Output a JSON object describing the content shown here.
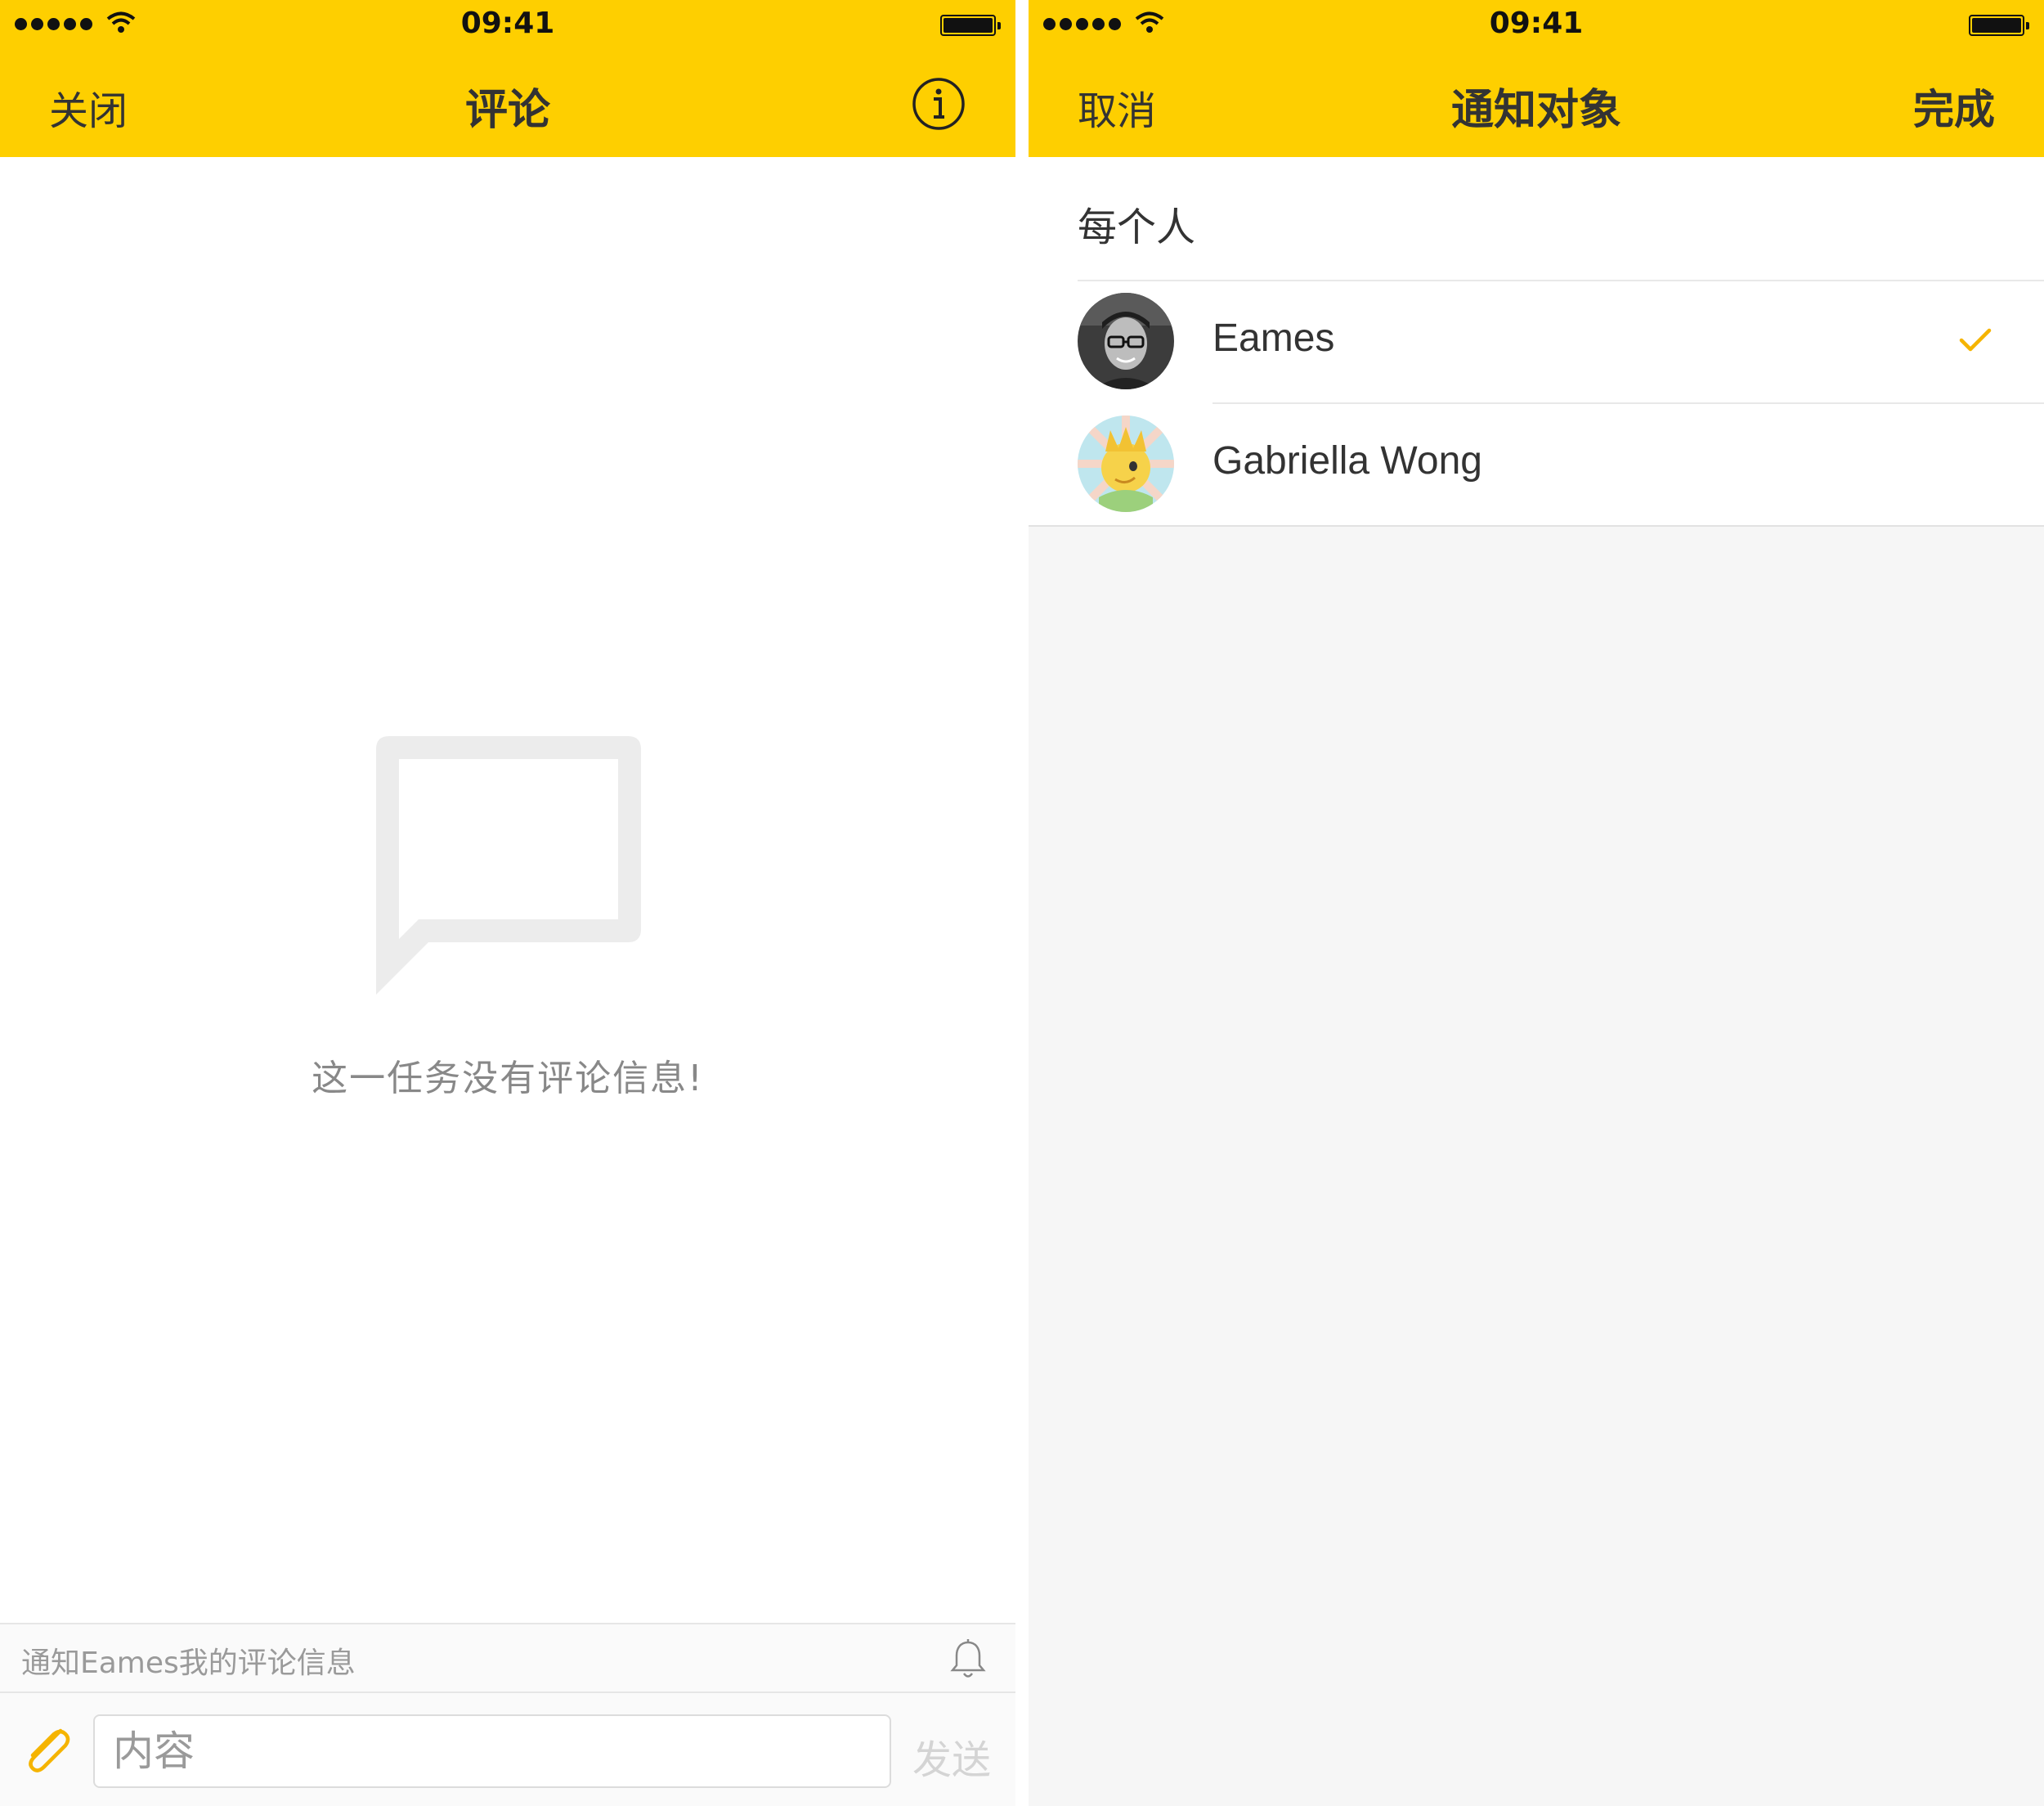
{
  "left_screen": {
    "status": {
      "time": "09:41"
    },
    "nav": {
      "left_label": "关闭",
      "title": "评论",
      "info_icon": "info-circle-icon"
    },
    "empty_state": {
      "icon": "speech-bubble-icon",
      "message": "这一任务没有评论信息!"
    },
    "notify_bar": {
      "text": "通知Eames我的评论信息",
      "icon": "bell-icon"
    },
    "composer": {
      "attach_icon": "paperclip-icon",
      "placeholder": "内容",
      "value": "",
      "send_label": "发送"
    }
  },
  "right_screen": {
    "status": {
      "time": "09:41"
    },
    "nav": {
      "left_label": "取消",
      "title": "通知对象",
      "right_label": "完成"
    },
    "everyone_label": "每个人",
    "people": [
      {
        "name": "Eames",
        "selected": true
      },
      {
        "name": "Gabriella Wong",
        "selected": false
      }
    ]
  },
  "colors": {
    "accent": "#fecf00",
    "check": "#f5b400",
    "text": "#333333",
    "muted": "#9a9a9a"
  }
}
